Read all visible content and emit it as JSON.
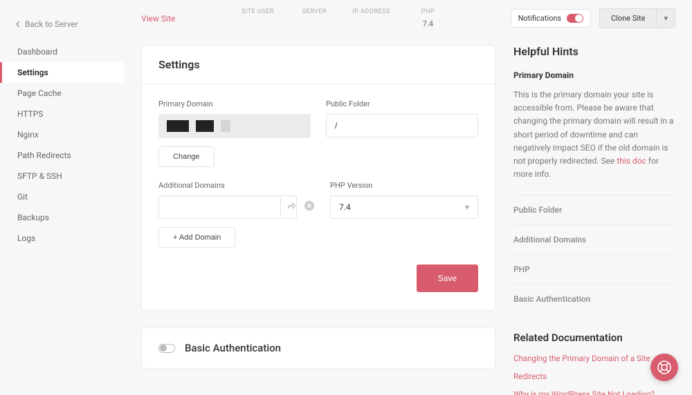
{
  "sidebar": {
    "back": "Back to Server",
    "items": [
      "Dashboard",
      "Settings",
      "Page Cache",
      "HTTPS",
      "Nginx",
      "Path Redirects",
      "SFTP & SSH",
      "Git",
      "Backups",
      "Logs"
    ],
    "active_index": 1
  },
  "topbar": {
    "view_site": "View Site",
    "meta": [
      {
        "label": "SITE USER",
        "value": ""
      },
      {
        "label": "SERVER",
        "value": ""
      },
      {
        "label": "IP ADDRESS",
        "value": ""
      },
      {
        "label": "PHP",
        "value": "7.4"
      }
    ],
    "notifications_label": "Notifications",
    "clone_label": "Clone Site"
  },
  "settings_card": {
    "title": "Settings",
    "primary_domain_label": "Primary Domain",
    "public_folder_label": "Public Folder",
    "public_folder_value": "/",
    "change_btn": "Change",
    "additional_domains_label": "Additional Domains",
    "php_version_label": "PHP Version",
    "php_version_value": "7.4",
    "add_domain_btn": "+ Add Domain",
    "save_btn": "Save"
  },
  "auth_card": {
    "title": "Basic Authentication"
  },
  "hints": {
    "title": "Helpful Hints",
    "primary": {
      "heading": "Primary Domain",
      "text_pre": "This is the primary domain your site is accessible from. Please be aware that changing the primary domain will result in a short period of downtime and can negatively impact SEO if the old domain is not properly redirected. See ",
      "link": "this doc",
      "text_post": " for more info."
    },
    "items": [
      "Public Folder",
      "Additional Domains",
      "PHP",
      "Basic Authentication"
    ],
    "related_title": "Related Documentation",
    "docs": [
      "Changing the Primary Domain of a Site",
      "Redirects",
      "Why is my WordPress Site Not Loading?"
    ]
  }
}
